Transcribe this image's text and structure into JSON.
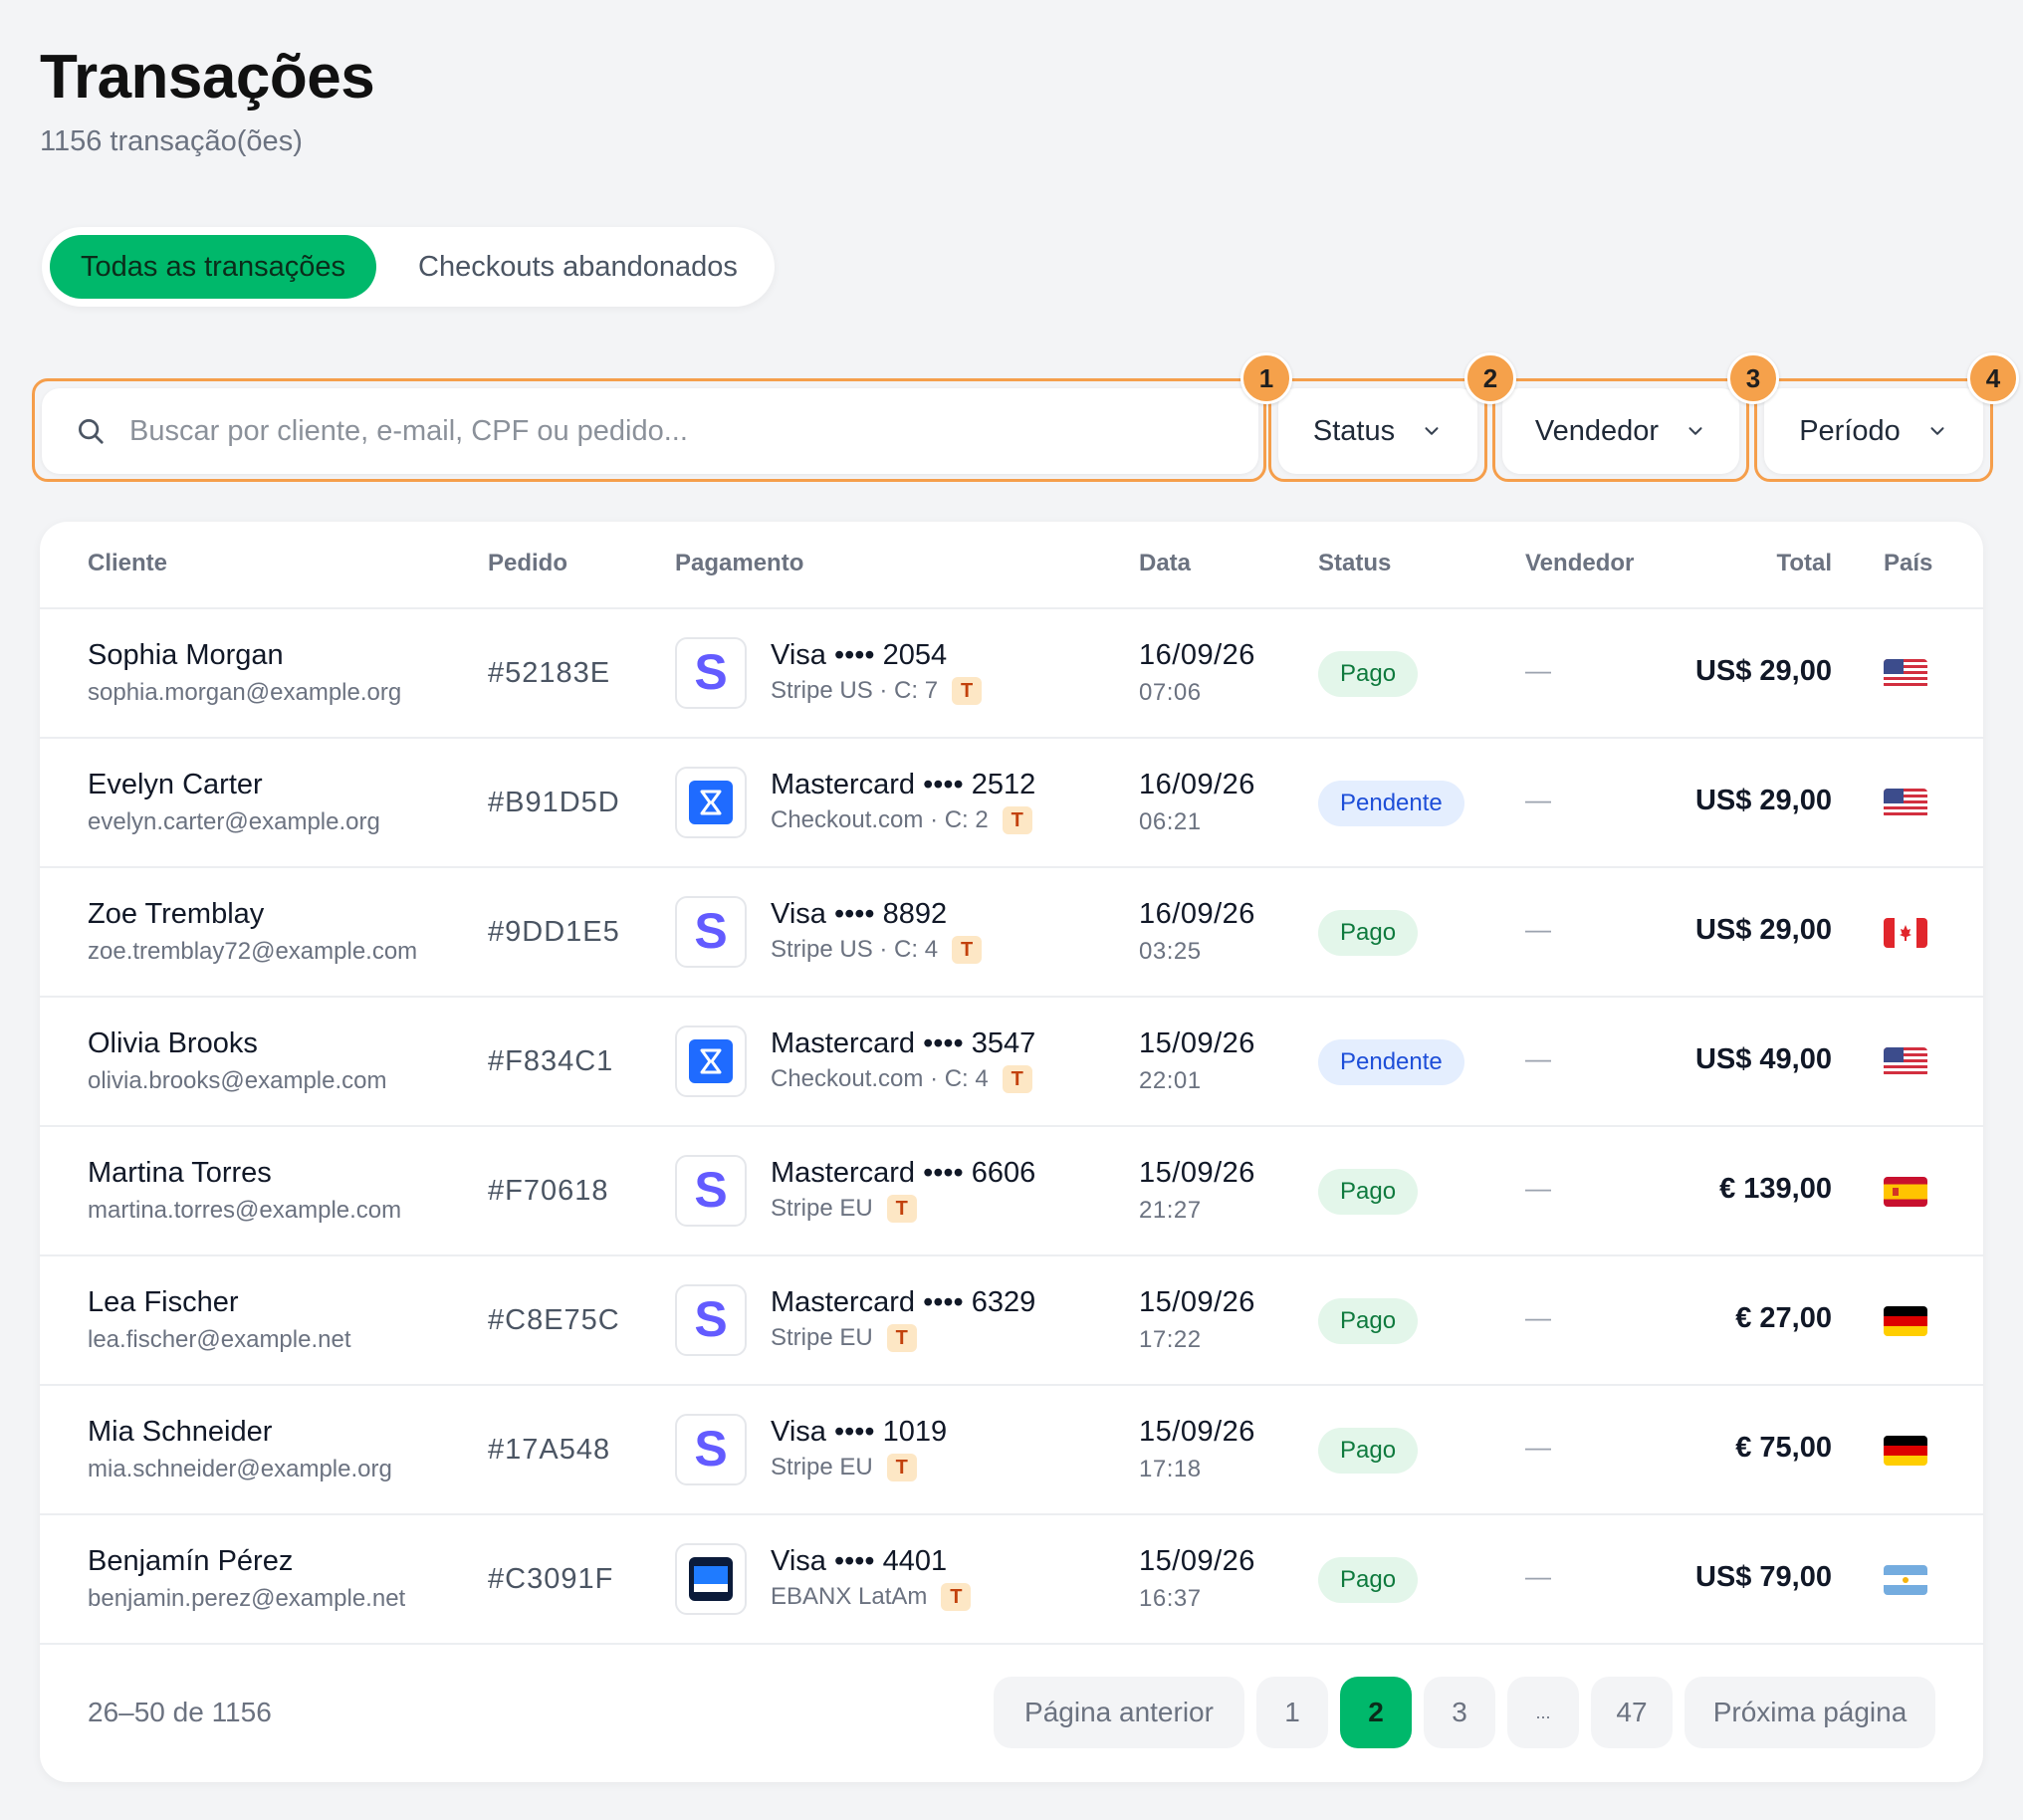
{
  "header": {
    "title": "Transações",
    "subtitle": "1156 transação(ões)"
  },
  "tabs": [
    {
      "label": "Todas as transações",
      "active": true
    },
    {
      "label": "Checkouts abandonados",
      "active": false
    }
  ],
  "search": {
    "placeholder": "Buscar por cliente, e-mail, CPF ou pedido...",
    "value": ""
  },
  "filters": [
    {
      "label": "Status",
      "marker": "1"
    },
    {
      "label": "Vendedor",
      "marker": "2"
    },
    {
      "label": "Período",
      "marker": "3"
    }
  ],
  "search_marker": "",
  "extra_marker": "4",
  "columns": {
    "cliente": "Cliente",
    "pedido": "Pedido",
    "pagamento": "Pagamento",
    "data": "Data",
    "status": "Status",
    "vendedor": "Vendedor",
    "total": "Total",
    "pais": "País"
  },
  "rows": [
    {
      "name": "Sophia Morgan",
      "email": "sophia.morgan@example.org",
      "order": "#52183E",
      "gateway_logo": "stripe-icon",
      "card": "Visa •••• 2054",
      "gateway": "Stripe US · C: 7",
      "badge": "T",
      "date": "16/09/26",
      "time": "07:06",
      "status": "Pago",
      "status_kind": "paid",
      "seller": "—",
      "total": "US$ 29,00",
      "flag": "us-flag-icon"
    },
    {
      "name": "Evelyn Carter",
      "email": "evelyn.carter@example.org",
      "order": "#B91D5D",
      "gateway_logo": "checkout-com-icon",
      "card": "Mastercard •••• 2512",
      "gateway": "Checkout.com · C: 2",
      "badge": "T",
      "date": "16/09/26",
      "time": "06:21",
      "status": "Pendente",
      "status_kind": "pending",
      "seller": "—",
      "total": "US$ 29,00",
      "flag": "us-flag-icon"
    },
    {
      "name": "Zoe Tremblay",
      "email": "zoe.tremblay72@example.com",
      "order": "#9DD1E5",
      "gateway_logo": "stripe-icon",
      "card": "Visa •••• 8892",
      "gateway": "Stripe US · C: 4",
      "badge": "T",
      "date": "16/09/26",
      "time": "03:25",
      "status": "Pago",
      "status_kind": "paid",
      "seller": "—",
      "total": "US$ 29,00",
      "flag": "ca-flag-icon"
    },
    {
      "name": "Olivia Brooks",
      "email": "olivia.brooks@example.com",
      "order": "#F834C1",
      "gateway_logo": "checkout-com-icon",
      "card": "Mastercard •••• 3547",
      "gateway": "Checkout.com · C: 4",
      "badge": "T",
      "date": "15/09/26",
      "time": "22:01",
      "status": "Pendente",
      "status_kind": "pending",
      "seller": "—",
      "total": "US$ 49,00",
      "flag": "us-flag-icon"
    },
    {
      "name": "Martina Torres",
      "email": "martina.torres@example.com",
      "order": "#F70618",
      "gateway_logo": "stripe-icon",
      "card": "Mastercard •••• 6606",
      "gateway": "Stripe EU",
      "badge": "T",
      "date": "15/09/26",
      "time": "21:27",
      "status": "Pago",
      "status_kind": "paid",
      "seller": "—",
      "total": "€ 139,00",
      "flag": "es-flag-icon"
    },
    {
      "name": "Lea Fischer",
      "email": "lea.fischer@example.net",
      "order": "#C8E75C",
      "gateway_logo": "stripe-icon",
      "card": "Mastercard •••• 6329",
      "gateway": "Stripe EU",
      "badge": "T",
      "date": "15/09/26",
      "time": "17:22",
      "status": "Pago",
      "status_kind": "paid",
      "seller": "—",
      "total": "€ 27,00",
      "flag": "de-flag-icon"
    },
    {
      "name": "Mia Schneider",
      "email": "mia.schneider@example.org",
      "order": "#17A548",
      "gateway_logo": "stripe-icon",
      "card": "Visa •••• 1019",
      "gateway": "Stripe EU",
      "badge": "T",
      "date": "15/09/26",
      "time": "17:18",
      "status": "Pago",
      "status_kind": "paid",
      "seller": "—",
      "total": "€ 75,00",
      "flag": "de-flag-icon"
    },
    {
      "name": "Benjamín Pérez",
      "email": "benjamin.perez@example.net",
      "order": "#C3091F",
      "gateway_logo": "ebanx-icon",
      "card": "Visa •••• 4401",
      "gateway": "EBANX LatAm",
      "badge": "T",
      "date": "15/09/26",
      "time": "16:37",
      "status": "Pago",
      "status_kind": "paid",
      "seller": "—",
      "total": "US$ 79,00",
      "flag": "ar-flag-icon"
    }
  ],
  "pagination": {
    "info": "26–50 de 1156",
    "prev": "Página anterior",
    "pages": [
      "1",
      "2",
      "3",
      "...",
      "47"
    ],
    "current": "2",
    "next": "Próxima página"
  },
  "colors": {
    "accent": "#00b86b",
    "highlight": "#f59e4b",
    "paid_bg": "#e3f6ea",
    "pending_bg": "#e4eefe"
  }
}
